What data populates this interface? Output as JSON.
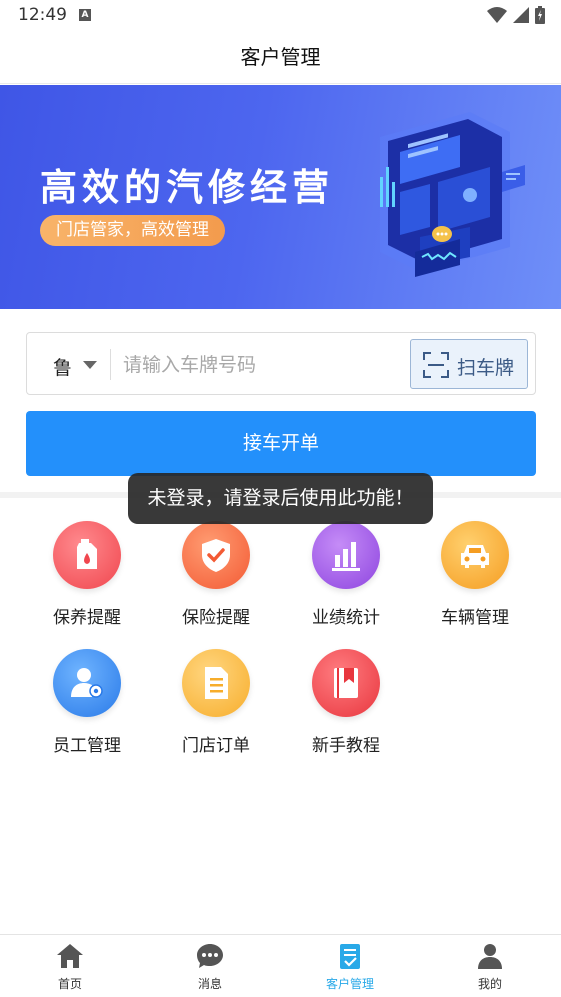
{
  "status_bar": {
    "time": "12:49",
    "a_badge": "A"
  },
  "header": {
    "title": "客户管理"
  },
  "banner": {
    "title": "高效的汽修经营",
    "subtitle": "门店管家，高效管理"
  },
  "search": {
    "province": "鲁",
    "placeholder": "请输入车牌号码",
    "value": "",
    "scan_label": "扫车牌"
  },
  "primary_action": {
    "label": "接车开单"
  },
  "toast": {
    "message": "未登录，请登录后使用此功能！"
  },
  "features": [
    {
      "label": "保养提醒",
      "icon": "oil-can-icon",
      "color": "#f2545b"
    },
    {
      "label": "保险提醒",
      "icon": "shield-check-icon",
      "color": "#f6673f"
    },
    {
      "label": "业绩统计",
      "icon": "bar-chart-icon",
      "color": "#9b55e4"
    },
    {
      "label": "车辆管理",
      "icon": "car-icon",
      "color": "#f6a52c"
    },
    {
      "label": "员工管理",
      "icon": "staff-gear-icon",
      "color": "#2e86ee"
    },
    {
      "label": "门店订单",
      "icon": "document-icon",
      "color": "#f8b432"
    },
    {
      "label": "新手教程",
      "icon": "book-icon",
      "color": "#f0484f"
    }
  ],
  "tabs": [
    {
      "label": "首页",
      "icon": "home-icon",
      "active": false
    },
    {
      "label": "消息",
      "icon": "message-icon",
      "active": false
    },
    {
      "label": "客户管理",
      "icon": "clipboard-check-icon",
      "active": true
    },
    {
      "label": "我的",
      "icon": "user-icon",
      "active": false
    }
  ],
  "colors": {
    "primary": "#2390fb",
    "active_tab": "#29a9e8",
    "inactive_tab": "#555555"
  }
}
